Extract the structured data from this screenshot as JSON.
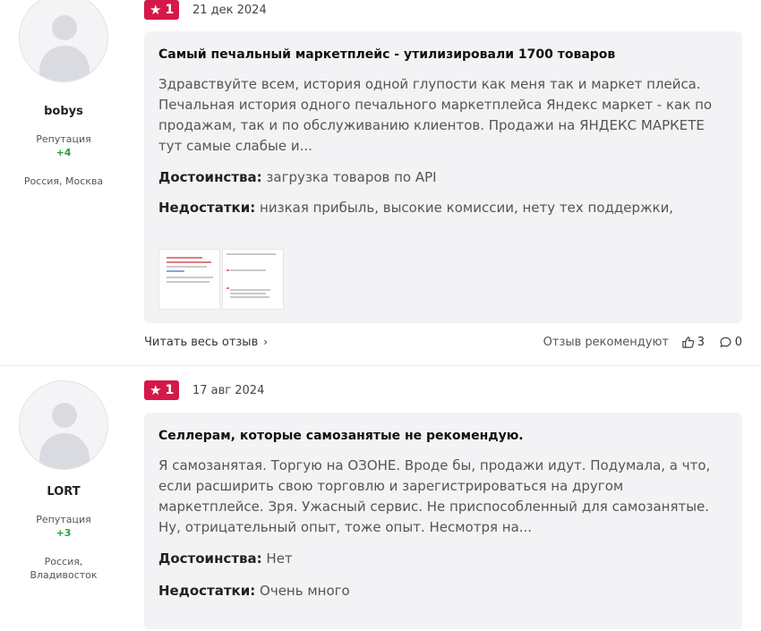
{
  "reviews": [
    {
      "author": "bobys",
      "reputation_label": "Репутация",
      "reputation_value": "+4",
      "location": "Россия, Москва",
      "rating": "1",
      "date": "21 дек 2024",
      "title": "Самый печальный маркетплейс - утилизировали 1700 товаров",
      "text": "Здравствуйте всем, история одной глупости как меня так и маркет плейса. Печальная история одного печального маркетплейса Яндекс маркет - как по продажам, так и по обслуживанию клиентов. Продажи на ЯНДЕКС МАРКЕТЕ тут самые слабые и...",
      "pros_label": "Достоинства:",
      "pros": "загрузка товаров по API",
      "cons_label": "Недостатки:",
      "cons": "низкая прибыль, высокие комиссии, нету тех поддержки,",
      "read_more": "Читать весь отзыв",
      "recommend": "Отзыв рекомендуют",
      "likes": "3",
      "comments": "0"
    },
    {
      "author": "LORT",
      "reputation_label": "Репутация",
      "reputation_value": "+3",
      "location": "Россия, Владивосток",
      "rating": "1",
      "date": "17 авг 2024",
      "title": "Селлерам, которые самозанятые не рекомендую.",
      "text": "Я самозанятая. Торгую на ОЗОНЕ. Вроде бы, продажи идут. Подумала, а что, если расширить свою торговлю и зарегистрироваться на другом маркетплейсе. Зря. Ужасный сервис. Не приспособленный для самозанятые. Ну, отрицательный опыт, тоже опыт. Несмотря на...",
      "pros_label": "Достоинства:",
      "pros": "Нет",
      "cons_label": "Недостатки:",
      "cons": "Очень много"
    }
  ],
  "icons": {
    "star": "star-icon",
    "like": "thumbs-up-icon",
    "comment": "comment-icon",
    "chevron": "chevron-right-icon"
  },
  "colors": {
    "rating_badge": "#d5184a",
    "reputation_positive": "#2aa13b",
    "card_bg": "#f3f3f5"
  }
}
